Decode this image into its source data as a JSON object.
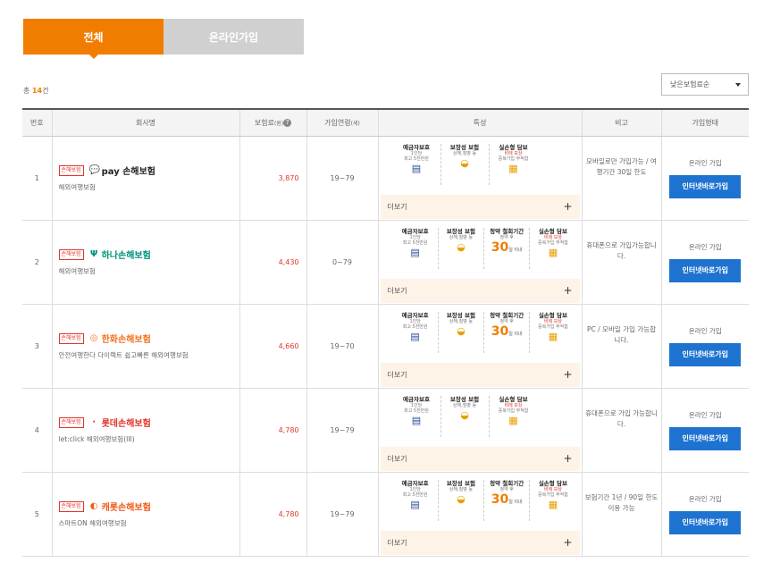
{
  "tabs": [
    {
      "label": "전체",
      "active": true
    },
    {
      "label": "온라인가입",
      "active": false
    }
  ],
  "total": {
    "prefix": "총",
    "count": "14",
    "suffix": "건"
  },
  "sort": {
    "selected": "낮은보험료순"
  },
  "table": {
    "headers": {
      "no": "번호",
      "company": "회사명",
      "premium": "보험료",
      "premium_unit": "(원)",
      "age": "가입연령",
      "age_unit": "(세)",
      "features": "특성",
      "note": "비고",
      "join": "가입형태"
    },
    "more_label": "더보기",
    "rows": [
      {
        "no": "1",
        "tag": "손해보험",
        "company": "pay 손해보험",
        "product": "해외여행보험",
        "premium": "3,870",
        "age": "19~79",
        "note": "모바일로만 가입가능 / 여행기간 30일 한도",
        "join_type": "온라인 가입",
        "join_button": "인터넷바로가입",
        "features": [
          {
            "title": "예금자보호",
            "lines": [
              "1인당",
              "최고 5천만원"
            ],
            "icon": "badge"
          },
          {
            "title": "보장성 보험",
            "lines": [
              "상해,질병 등"
            ],
            "icon": "bowl"
          },
          {
            "title": "실손형 담보",
            "lines": [
              "비례 보상",
              "중복가입 부적합"
            ],
            "icon": "doc"
          }
        ]
      },
      {
        "no": "2",
        "tag": "손해보험",
        "company": "하나손해보험",
        "product": "해외여행보험",
        "premium": "4,430",
        "age": "0~79",
        "note": "휴대폰으로 가입가능합니다.",
        "join_type": "온라인 가입",
        "join_button": "인터넷바로가입",
        "features": [
          {
            "title": "예금자보호",
            "lines": [
              "1인당",
              "최고 5천만원"
            ],
            "icon": "badge"
          },
          {
            "title": "보장성 보험",
            "lines": [
              "상해,질병 등"
            ],
            "icon": "bowl"
          },
          {
            "title": "청약 철회기간",
            "lines": [
              "청약 후"
            ],
            "big": "30",
            "big_unit": "일 이내"
          },
          {
            "title": "실손형 담보",
            "lines": [
              "비례 보상",
              "중복가입 부적합"
            ],
            "icon": "doc"
          }
        ]
      },
      {
        "no": "3",
        "tag": "손해보험",
        "company": "한화손해보험",
        "product": "안전여행한다 다이렉트 쉽고빠른 해외여행보험",
        "premium": "4,660",
        "age": "19~70",
        "note": "PC / 모바일 가입 가능합니다.",
        "join_type": "온라인 가입",
        "join_button": "인터넷바로가입",
        "features": [
          {
            "title": "예금자보호",
            "lines": [
              "1인당",
              "최고 5천만원"
            ],
            "icon": "badge"
          },
          {
            "title": "보장성 보험",
            "lines": [
              "상해,질병 등"
            ],
            "icon": "bowl"
          },
          {
            "title": "청약 철회기간",
            "lines": [
              "청약 후"
            ],
            "big": "30",
            "big_unit": "일 이내"
          },
          {
            "title": "실손형 담보",
            "lines": [
              "비례 보상",
              "중복가입 부적합"
            ],
            "icon": "doc"
          }
        ]
      },
      {
        "no": "4",
        "tag": "손해보험",
        "company": "롯데손해보험",
        "product": "let:click 해외여행보험(III)",
        "premium": "4,780",
        "age": "19~79",
        "note": "휴대폰으로 가입 가능합니다.",
        "join_type": "온라인 가입",
        "join_button": "인터넷바로가입",
        "features": [
          {
            "title": "예금자보호",
            "lines": [
              "1인당",
              "최고 5천만원"
            ],
            "icon": "badge"
          },
          {
            "title": "보장성 보험",
            "lines": [
              "상해,질병 등"
            ],
            "icon": "bowl"
          },
          {
            "title": "실손형 담보",
            "lines": [
              "비례 보상",
              "중복가입 부적합"
            ],
            "icon": "doc"
          }
        ]
      },
      {
        "no": "5",
        "tag": "손해보험",
        "company": "캐롯손해보험",
        "product": "스마트ON 해외여행보험",
        "premium": "4,780",
        "age": "19~79",
        "note": "보험기간 1년 / 90일 한도 이용 가능",
        "join_type": "온라인 가입",
        "join_button": "인터넷바로가입",
        "features": [
          {
            "title": "예금자보호",
            "lines": [
              "1인당",
              "최고 5천만원"
            ],
            "icon": "badge"
          },
          {
            "title": "보장성 보험",
            "lines": [
              "상해,질병 등"
            ],
            "icon": "bowl"
          },
          {
            "title": "청약 철회기간",
            "lines": [
              "청약 후"
            ],
            "big": "30",
            "big_unit": "일 이내"
          },
          {
            "title": "실손형 담보",
            "lines": [
              "비례 보상",
              "중복가입 부적합"
            ],
            "icon": "doc"
          }
        ]
      }
    ]
  },
  "logo_colors": {
    "pay": "#222222",
    "hana": "#00927a",
    "hanwha": "#f37321",
    "lotte": "#e0362b",
    "carrot": "#ef5a1a"
  }
}
